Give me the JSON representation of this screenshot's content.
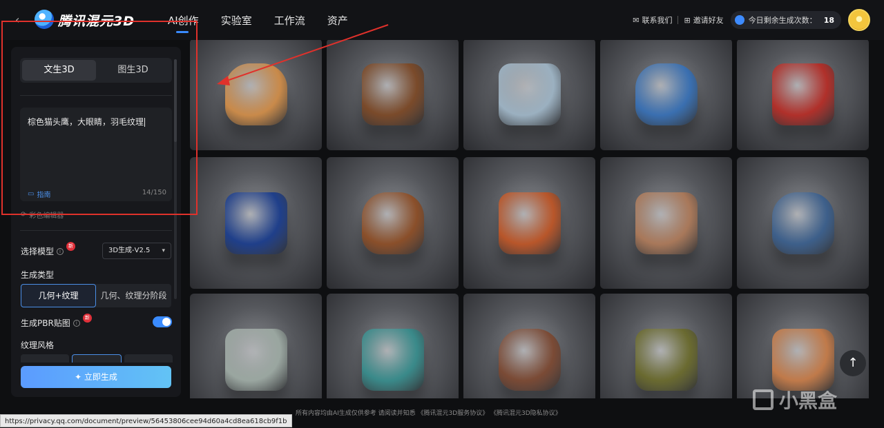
{
  "header": {
    "back_icon": "chevron-left-icon",
    "logo_text": "腾讯混元3D",
    "nav": [
      {
        "label": "AI创作",
        "active": true
      },
      {
        "label": "实验室",
        "active": false
      },
      {
        "label": "工作流",
        "active": false
      },
      {
        "label": "资产",
        "active": false
      }
    ],
    "contact": "联系我们",
    "invite": "邀请好友",
    "quota_label": "今日剩余生成次数：",
    "quota_value": "18"
  },
  "panel": {
    "tabs": [
      "文生3D",
      "图生3D"
    ],
    "active_tab": 0,
    "prompt_text": "棕色猫头鹰，大眼睛，羽毛纹理",
    "guide": "指南",
    "char_count": "14/150",
    "random": "彩色编辑器",
    "model_label": "选择模型",
    "new_badge": "新",
    "model_value": "3D生成-V2.5",
    "gen_type_label": "生成类型",
    "gen_type_options": [
      "几何+纹理",
      "几何、纹理分阶段"
    ],
    "gen_type_active": 0,
    "pbr_label": "生成PBR贴图",
    "pbr_on": true,
    "texture_style_label": "纹理风格",
    "generate_button": "✦ 立即生成"
  },
  "gallery": {
    "items": [
      "hoverbike",
      "wooden-tray",
      "factory",
      "ninja-robot",
      "holly-berries",
      "blue-vase",
      "wooden-bench",
      "toy-plane",
      "cartoon-head",
      "treasure-chest",
      "horse-statue",
      "mech-robot",
      "leather-collar",
      "helmet",
      "copper-mug"
    ]
  },
  "footer": {
    "text": "所有内容均由AI生成仅供参考 请阅读并知悉 《腾讯混元3D服务协议》 《腾讯混元3D隐私协议》",
    "status_url": "https://privacy.qq.com/document/preview/56453806cee94d60a4cd8ea618cb9f1b",
    "watermark": "小黑盒"
  },
  "colors": {
    "accent": "#3a8bff",
    "annotation": "#e0312b"
  }
}
